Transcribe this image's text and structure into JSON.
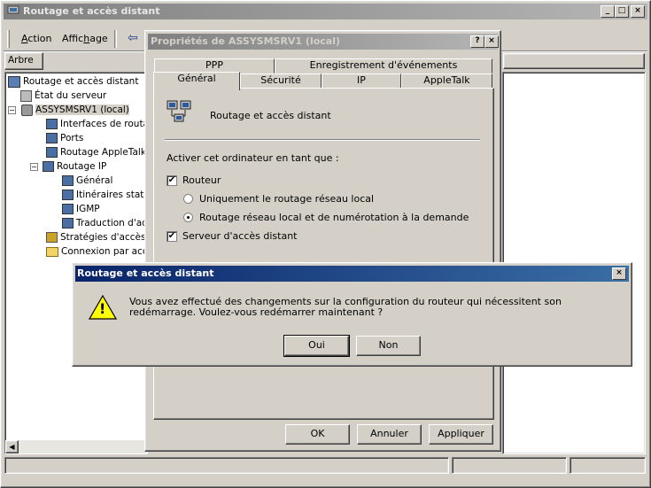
{
  "main_window": {
    "title": "Routage et accès distant",
    "menu": {
      "action": "Action",
      "affichage": "Affichage"
    },
    "tree_tab": "Arbre",
    "tree": [
      "Routage et accès distant",
      "État du serveur",
      "ASSYSMSRV1 (local)",
      "Interfaces de routag",
      "Ports",
      "Routage AppleTalk",
      "Routage IP",
      "Général",
      "Itinéraires statiq",
      "IGMP",
      "Traduction d'adr",
      "Stratégies d'accès di",
      "Connexion par accès"
    ],
    "title_buttons": {
      "minimize": "_",
      "maximize": "□",
      "close": "×"
    }
  },
  "props_dialog": {
    "title": "Propriétés de ASSYSMSRV1 (local)",
    "help": "?",
    "close": "×",
    "tabs_back": [
      "PPP",
      "Enregistrement d'événements"
    ],
    "tabs_front": [
      "Général",
      "Sécurité",
      "IP",
      "AppleTalk"
    ],
    "header_text": "Routage et accès distant",
    "enable_label": "Activer cet ordinateur en tant que :",
    "router_label": "Routeur",
    "router_checked": true,
    "radio_local": "Uniquement le routage réseau local",
    "radio_demand": "Routage réseau local et de numérotation à la demande",
    "selected_radio": "demand",
    "ras_label": "Serveur d'accès distant",
    "ras_checked": true,
    "check_mark": "✔",
    "buttons": {
      "ok": "OK",
      "cancel": "Annuler",
      "apply": "Appliquer"
    }
  },
  "message_box": {
    "title": "Routage et accès distant",
    "close": "×",
    "icon": "warning-icon",
    "icon_glyph": "!",
    "message": "Vous avez effectué des changements sur la configuration du routeur qui nécessitent son redémarrage. Voulez-vous redémarrer maintenant ?",
    "yes": "Oui",
    "no": "Non"
  },
  "colors": {
    "title_active": "#0a246a",
    "title_inactive": "#808080",
    "face": "#d4d0c8"
  }
}
